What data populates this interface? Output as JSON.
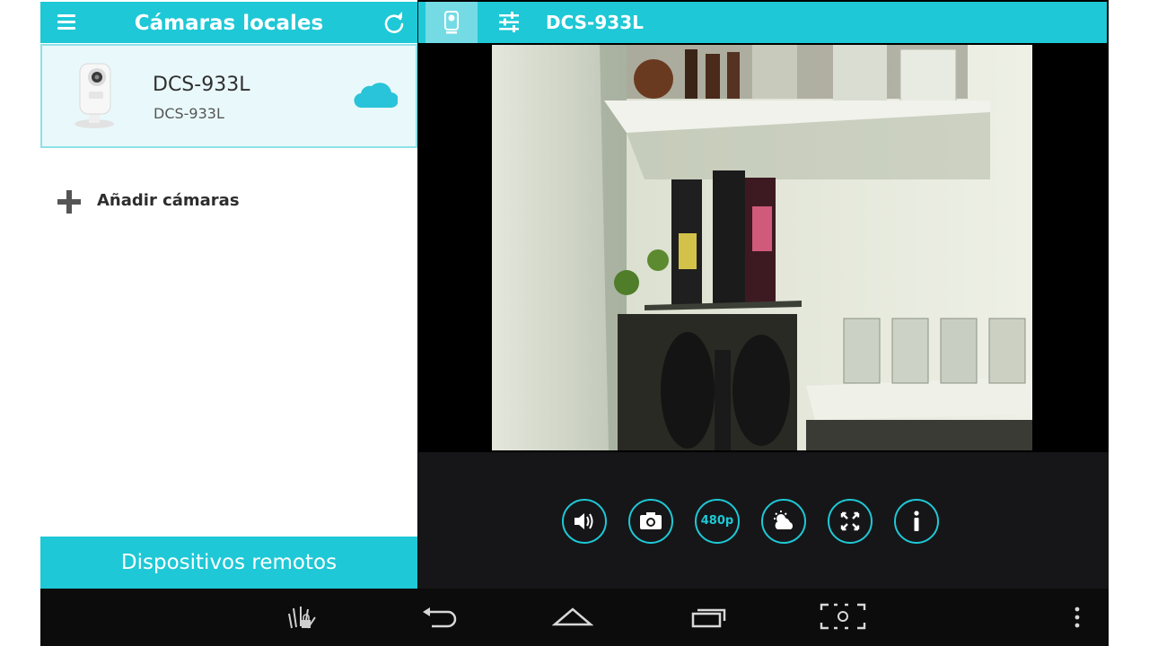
{
  "left_panel": {
    "title": "Cámaras locales",
    "camera": {
      "name": "DCS-933L",
      "model": "DCS-933L"
    },
    "add_label": "Añadir cámaras",
    "remote_label": "Dispositivos remotos"
  },
  "right_panel": {
    "title": "DCS-933L"
  },
  "controls": {
    "resolution_label": "480p",
    "buttons": [
      "speaker-icon",
      "snapshot-icon",
      "resolution",
      "day-night-icon",
      "fullscreen-icon",
      "info-icon"
    ]
  },
  "colors": {
    "accent": "#1ec8d6",
    "background": "#0c0c0c"
  },
  "nav_icons": [
    "hand-lock-icon",
    "back-icon",
    "home-icon",
    "recent-apps-icon",
    "screenshot-icon",
    "overflow-menu-icon"
  ]
}
